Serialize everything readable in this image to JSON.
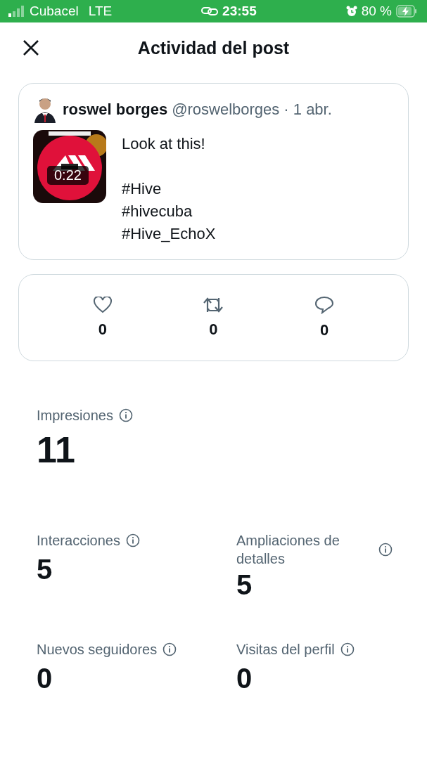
{
  "status_bar": {
    "carrier": "Cubacel",
    "network": "LTE",
    "time": "23:55",
    "battery": "80 %"
  },
  "header": {
    "title": "Actividad del post"
  },
  "post": {
    "name": "roswel borges",
    "handle": "@roswelborges",
    "date": "· 1 abr.",
    "media": {
      "kind": "picture",
      "duration": "0:22"
    },
    "text": "Look at this!",
    "hashtags": [
      "#Hive",
      "#hivecuba",
      "#Hive_EchoX"
    ]
  },
  "engagement": [
    {
      "kind": "like",
      "count": "0"
    },
    {
      "kind": "repost",
      "count": "0"
    },
    {
      "kind": "reply",
      "count": "0"
    }
  ],
  "impressions": {
    "label": "Impresiones",
    "value": "11"
  },
  "metrics": [
    {
      "label": "Interacciones",
      "value": "5"
    },
    {
      "label": "Ampliaciones de detalles",
      "value": "5"
    },
    {
      "label": "Nuevos seguidores",
      "value": "0"
    },
    {
      "label": "Visitas del perfil",
      "value": "0"
    }
  ]
}
